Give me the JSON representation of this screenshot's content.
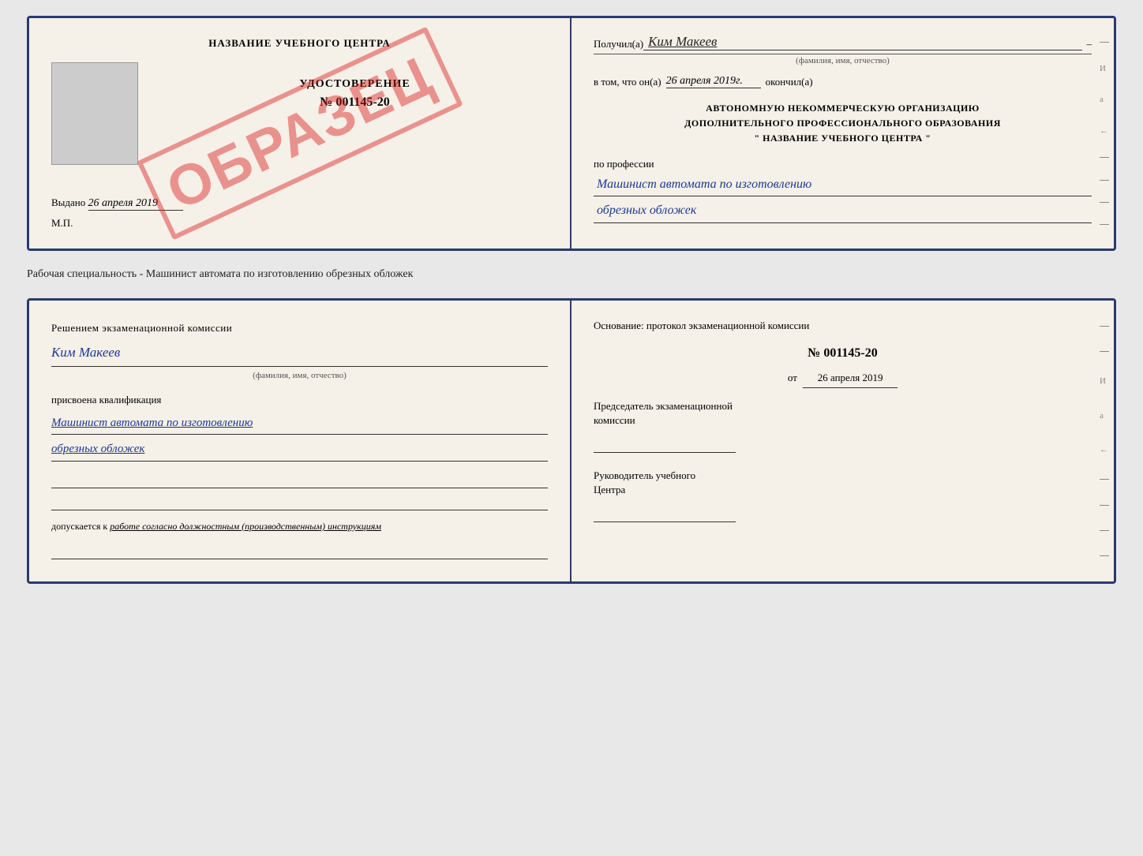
{
  "top_cert": {
    "left": {
      "title": "НАЗВАНИЕ УЧЕБНОГО ЦЕНТРА",
      "cert_label": "УДОСТОВЕРЕНИЕ",
      "cert_number": "№ 001145-20",
      "issued_label": "Выдано",
      "issued_date": "26 апреля 2019",
      "mp_label": "М.П.",
      "stamp_text": "ОБРАЗЕЦ"
    },
    "right": {
      "received_label": "Получил(а)",
      "received_name": "Ким Макеев",
      "name_subtitle": "(фамилия, имя, отчество)",
      "date_prefix": "в том, что он(а)",
      "date_value": "26 апреля 2019г.",
      "date_suffix": "окончил(а)",
      "org_line1": "АВТОНОМНУЮ НЕКОММЕРЧЕСКУЮ ОРГАНИЗАЦИЮ",
      "org_line2": "ДОПОЛНИТЕЛЬНОГО ПРОФЕССИОНАЛЬНОГО ОБРАЗОВАНИЯ",
      "org_line3": "\"  НАЗВАНИЕ УЧЕБНОГО ЦЕНТРА  \"",
      "profession_label": "по профессии",
      "profession_value": "Машинист автомата по изготовлению",
      "profession_value2": "обрезных обложек"
    }
  },
  "separator": {
    "text": "Рабочая специальность - Машинист автомата по изготовлению обрезных обложек"
  },
  "bottom_cert": {
    "left": {
      "decision_label": "Решением экзаменационной комиссии",
      "person_name": "Ким Макеев",
      "name_subtitle": "(фамилия, имя, отчество)",
      "qual_label": "присвоена квалификация",
      "qual_value1": "Машинист автомата по изготовлению",
      "qual_value2": "обрезных обложек",
      "допускается_label": "допускается к",
      "допускается_value": "работе согласно должностным (производственным) инструкциям"
    },
    "right": {
      "basis_label": "Основание: протокол экзаменационной комиссии",
      "protocol_number": "№  001145-20",
      "date_prefix": "от",
      "date_value": "26 апреля 2019",
      "chairman_label": "Председатель экзаменационной",
      "chairman_label2": "комиссии",
      "director_label": "Руководитель учебного",
      "director_label2": "Центра"
    }
  },
  "right_edge_symbols": [
    "И",
    "а",
    "←",
    "–",
    "–",
    "–",
    "–"
  ],
  "right_edge_symbols2": [
    "И",
    "а",
    "←",
    "–",
    "–",
    "–",
    "–"
  ]
}
